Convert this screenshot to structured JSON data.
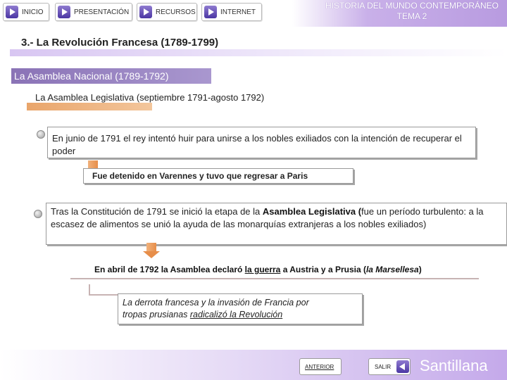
{
  "nav": {
    "inicio": "INICIO",
    "presentacion": "PRESENTACIÓN",
    "recursos": "RECURSOS",
    "internet": "INTERNET"
  },
  "header": {
    "title_line1": "HISTORIA DEL MUNDO CONTEMPORÁNEO",
    "title_line2": "TEMA 2"
  },
  "section": {
    "title": "3.- La Revolución Francesa (1789-1799)",
    "subtitle": "La Asamblea Nacional (1789-1792)",
    "subsubtitle": "La Asamblea Legislativa (septiembre 1791-agosto 1792)"
  },
  "content": {
    "box1": "En junio de 1791 el rey intentó huir para unirse a los nobles exiliados con la intención de  recuperar el poder",
    "box1_result": "Fue detenido en Varennes y tuvo que regresar a Paris",
    "box2_pre": "Tras la Constitución de 1791 se inició la etapa de la ",
    "box2_bold": "Asamblea Legislativa (",
    "box2_post": "fue un período turbulento: a la escasez de alimentos se unió la ayuda de las monarquías extranjeras a los nobles exiliados)",
    "box2_result_pre": "En abril de 1792 la Asamblea declaró ",
    "box2_result_link": "la guerra",
    "box2_result_mid": " a Austria y a Prusia (",
    "box2_result_italic": "la Marsellesa",
    "box2_result_end": ")",
    "box3_line1": "La derrota francesa y la invasión de Francia por",
    "box3_line2_pre": "tropas prusianas ",
    "box3_line2_link": "radicalizó la Revolución"
  },
  "footer": {
    "anterior": "ANTERIOR",
    "salir": "SALIR",
    "brand": "Santillana"
  }
}
